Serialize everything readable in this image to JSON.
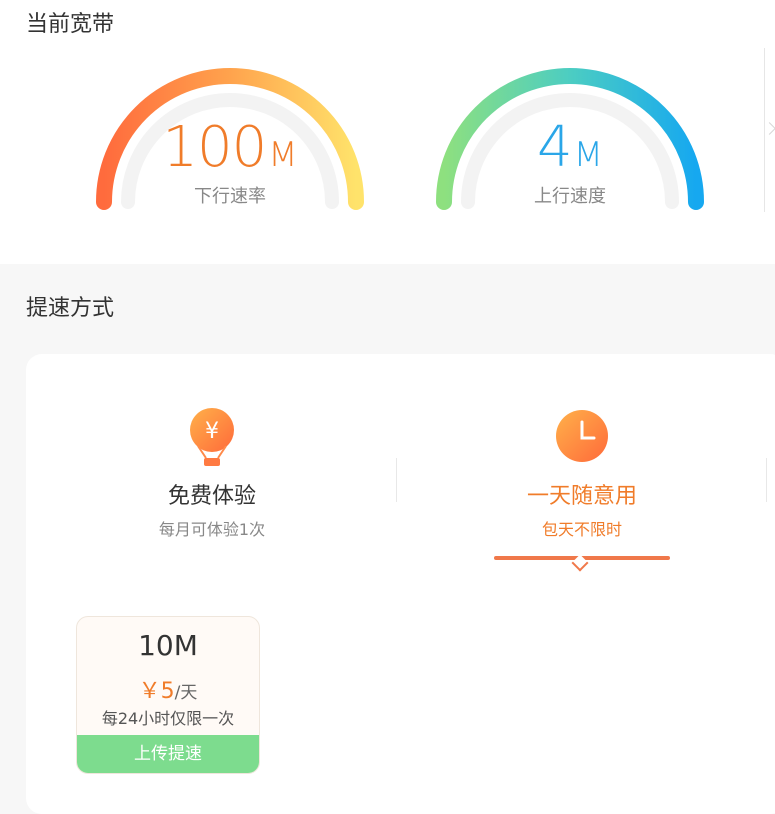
{
  "current_bandwidth": {
    "title": "当前宽带",
    "download": {
      "value": "100",
      "unit": "M",
      "label": "下行速率",
      "color": "#f07c2a"
    },
    "upload": {
      "value": "4",
      "unit": "M",
      "label": "上行速度",
      "color": "#2aa6e8"
    }
  },
  "speedup": {
    "title": "提速方式",
    "options": [
      {
        "icon": "hot-air-balloon-yuan-icon",
        "name": "免费体验",
        "desc": "每月可体验1次",
        "active": false
      },
      {
        "icon": "clock-icon",
        "name": "一天随意用",
        "desc": "包天不限时",
        "active": true
      }
    ],
    "plan": {
      "speed": "10M",
      "price": "￥5",
      "per": "/天",
      "limit": "每24小时仅限一次",
      "button": "上传提速"
    }
  },
  "colors": {
    "accent": "#f07c2a",
    "upload_blue": "#2aa6e8",
    "button_green": "#7ddc8e",
    "underline": "#f0784a"
  }
}
